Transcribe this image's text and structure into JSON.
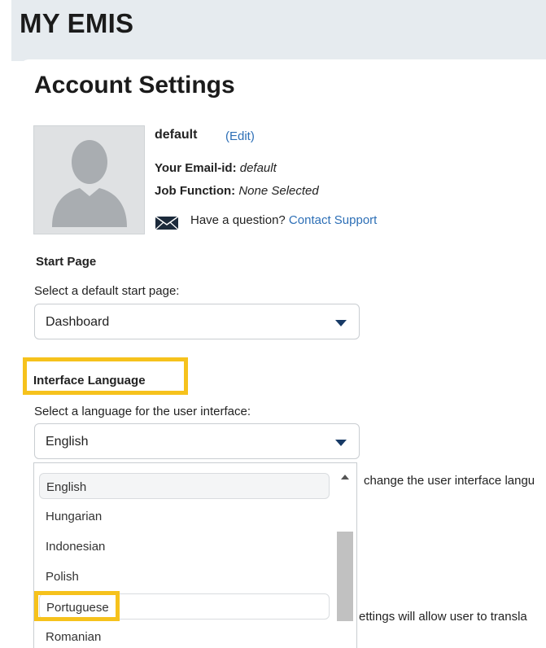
{
  "header": {
    "app_title": "MY EMIS"
  },
  "page": {
    "title": "Account Settings"
  },
  "profile": {
    "username": "default",
    "edit_label": "(Edit)",
    "email_label": "Your Email-id:",
    "email_value": "default",
    "job_label": "Job Function:",
    "job_value": "None Selected",
    "question_text": "Have a question?",
    "contact_link": "Contact Support"
  },
  "start_page": {
    "heading": "Start Page",
    "label": "Select a default start page:",
    "selected": "Dashboard"
  },
  "interface_language": {
    "heading": "Interface Language",
    "label": "Select a language for the user interface:",
    "selected": "English",
    "options": [
      "English",
      "Hungarian",
      "Indonesian",
      "Polish",
      "Portuguese",
      "Romanian"
    ]
  },
  "obscured_text": {
    "line1": "change the user interface langu",
    "line2": "ettings will allow user to transla"
  },
  "colors": {
    "link": "#2d6fb6",
    "highlight": "#f6c21c",
    "header_bg": "#e6ebef",
    "arrow": "#173a66"
  }
}
